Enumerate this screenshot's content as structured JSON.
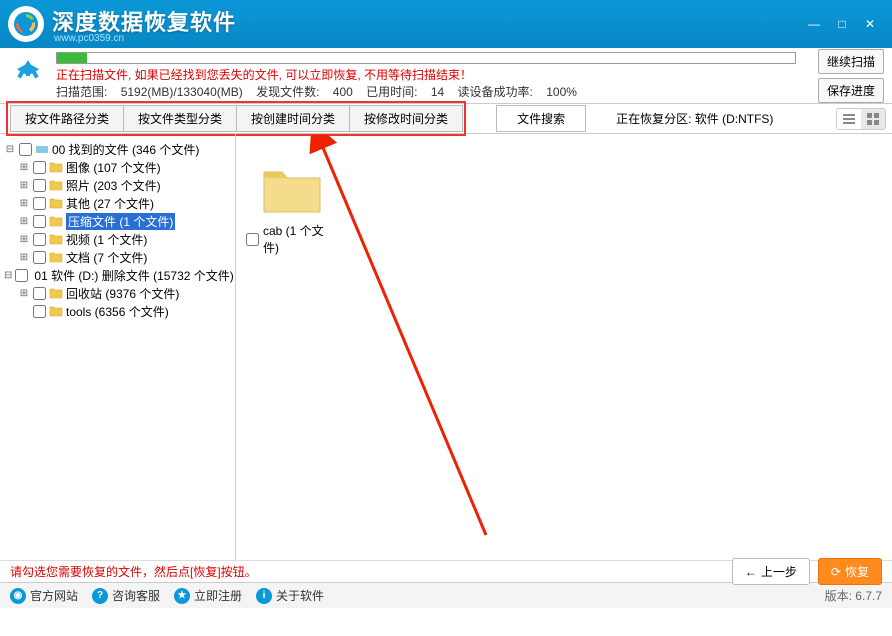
{
  "app": {
    "title": "深度数据恢复软件",
    "subtitle": "www.pc0359.cn"
  },
  "scan": {
    "message": "正在扫描文件, 如果已经找到您丢失的文件, 可以立即恢复, 不用等待扫描结束！",
    "range_label": "扫描范围:",
    "range_value": "5192(MB)/133040(MB)",
    "files_label": "发现文件数:",
    "files_value": "400",
    "time_label": "已用时间:",
    "time_value": "14",
    "rate_label": "读设备成功率:",
    "rate_value": "100%"
  },
  "buttons": {
    "continue_scan": "继续扫描",
    "save_progress": "保存进度",
    "prev": "上一步",
    "restore": "恢复"
  },
  "tabs": {
    "by_path": "按文件路径分类",
    "by_type": "按文件类型分类",
    "by_create": "按创建时间分类",
    "by_modify": "按修改时间分类",
    "search": "文件搜索"
  },
  "partition": {
    "label": "正在恢复分区:",
    "value": "软件 (D:NTFS)"
  },
  "tree": {
    "root1": "00 找到的文件 (346 个文件)",
    "images": "图像   (107 个文件)",
    "photos": "照片   (203 个文件)",
    "other": "其他  (27 个文件)",
    "archive": "压缩文件   (1 个文件)",
    "video": "视频   (1 个文件)",
    "docs": "文档   (7 个文件)",
    "root2": "01 软件 (D:) 删除文件 (15732 个文件)",
    "recycle": "回收站   (9376 个文件)",
    "tools": "tools   (6356 个文件)"
  },
  "content": {
    "item_label": "cab (1 个文件)"
  },
  "hint": "请勾选您需要恢复的文件，然后点[恢复]按钮。",
  "footer": {
    "site": "官方网站",
    "support": "咨询客服",
    "buy": "立即注册",
    "about": "关于软件",
    "version": "版本: 6.7.7"
  }
}
